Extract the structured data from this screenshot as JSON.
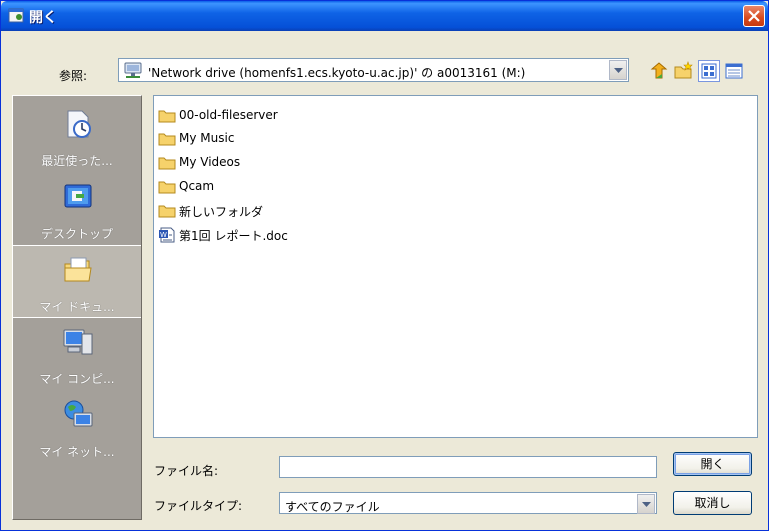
{
  "window": {
    "title": "開く",
    "accent": "#0550D7",
    "close_color": "#D84A1E"
  },
  "lookin": {
    "label": "参照:",
    "value": "'Network drive (homenfs1.ecs.kyoto-u.ac.jp)' の a0013161 (M:)"
  },
  "toolbar": {
    "icons": [
      "up-folder-icon",
      "new-folder-icon",
      "view-menu-icon",
      "details-view-icon"
    ]
  },
  "places": [
    {
      "label": "最近使った...",
      "icon": "recent-clock-icon"
    },
    {
      "label": "デスクトップ",
      "icon": "desktop-icon"
    },
    {
      "label": "マイ ドキュ...",
      "icon": "my-documents-icon"
    },
    {
      "label": "マイ コンピ...",
      "icon": "my-computer-icon"
    },
    {
      "label": "マイ ネット...",
      "icon": "network-places-icon"
    }
  ],
  "files": [
    {
      "name": "00-old-fileserver",
      "type": "folder"
    },
    {
      "name": "My Music",
      "type": "folder"
    },
    {
      "name": "My Videos",
      "type": "folder"
    },
    {
      "name": "Qcam",
      "type": "folder"
    },
    {
      "name": "新しいフォルダ",
      "type": "folder"
    },
    {
      "name": "第1回 レポート.doc",
      "type": "doc"
    }
  ],
  "filename": {
    "label": "ファイル名:",
    "value": ""
  },
  "filetype": {
    "label": "ファイルタイプ:",
    "value": "すべてのファイル"
  },
  "buttons": {
    "open": "開く",
    "cancel": "取消し"
  }
}
